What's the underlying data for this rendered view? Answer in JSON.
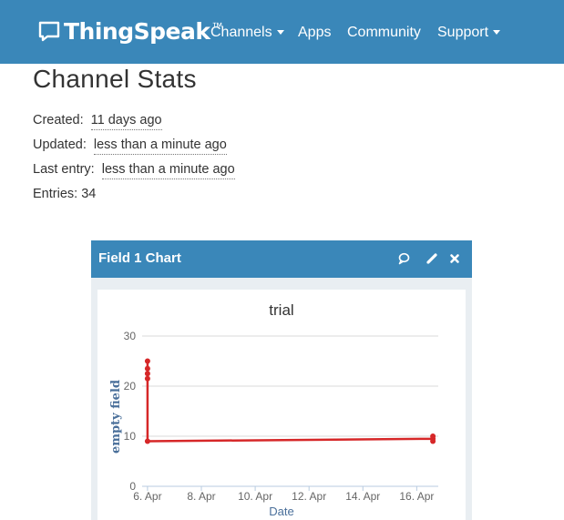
{
  "header": {
    "brand_name": "ThingSpeak",
    "brand_trademark": "™",
    "nav": [
      {
        "label": "Channels",
        "has_caret": true
      },
      {
        "label": "Apps",
        "has_caret": false
      },
      {
        "label": "Community",
        "has_caret": false
      },
      {
        "label": "Support",
        "has_caret": true
      }
    ],
    "colors": {
      "navbar": "#3a87b9"
    }
  },
  "main": {
    "title": "Channel Stats",
    "stats": [
      {
        "label": "Created:",
        "value": "11 days ago"
      },
      {
        "label": "Updated:",
        "value": "less than a minute ago"
      },
      {
        "label": "Last entry:",
        "value": "less than a minute ago"
      },
      {
        "label": "Entries:",
        "value": "34"
      }
    ]
  },
  "card": {
    "title": "Field 1 Chart",
    "tools": [
      "comment-icon",
      "pencil-icon",
      "close-icon"
    ]
  },
  "chart_data": {
    "type": "line",
    "title": "trial",
    "xlabel": "Date",
    "ylabel": "empty field",
    "ylim": [
      0,
      30
    ],
    "yticks": [
      "0",
      "10",
      "20",
      "30"
    ],
    "xticks": [
      "6. Apr",
      "8. Apr",
      "10. Apr",
      "12. Apr",
      "14. Apr",
      "16. Apr"
    ],
    "grid": true,
    "line_color": "#d62728",
    "series": [
      {
        "points": [
          {
            "x": 6.0,
            "y": 25
          },
          {
            "x": 6.0,
            "y": 23.5
          },
          {
            "x": 6.0,
            "y": 22.5
          },
          {
            "x": 6.0,
            "y": 21.5
          },
          {
            "x": 6.0,
            "y": 9
          },
          {
            "x": 16.6,
            "y": 9.5
          },
          {
            "x": 16.6,
            "y": 9
          },
          {
            "x": 16.6,
            "y": 10
          }
        ]
      }
    ]
  }
}
